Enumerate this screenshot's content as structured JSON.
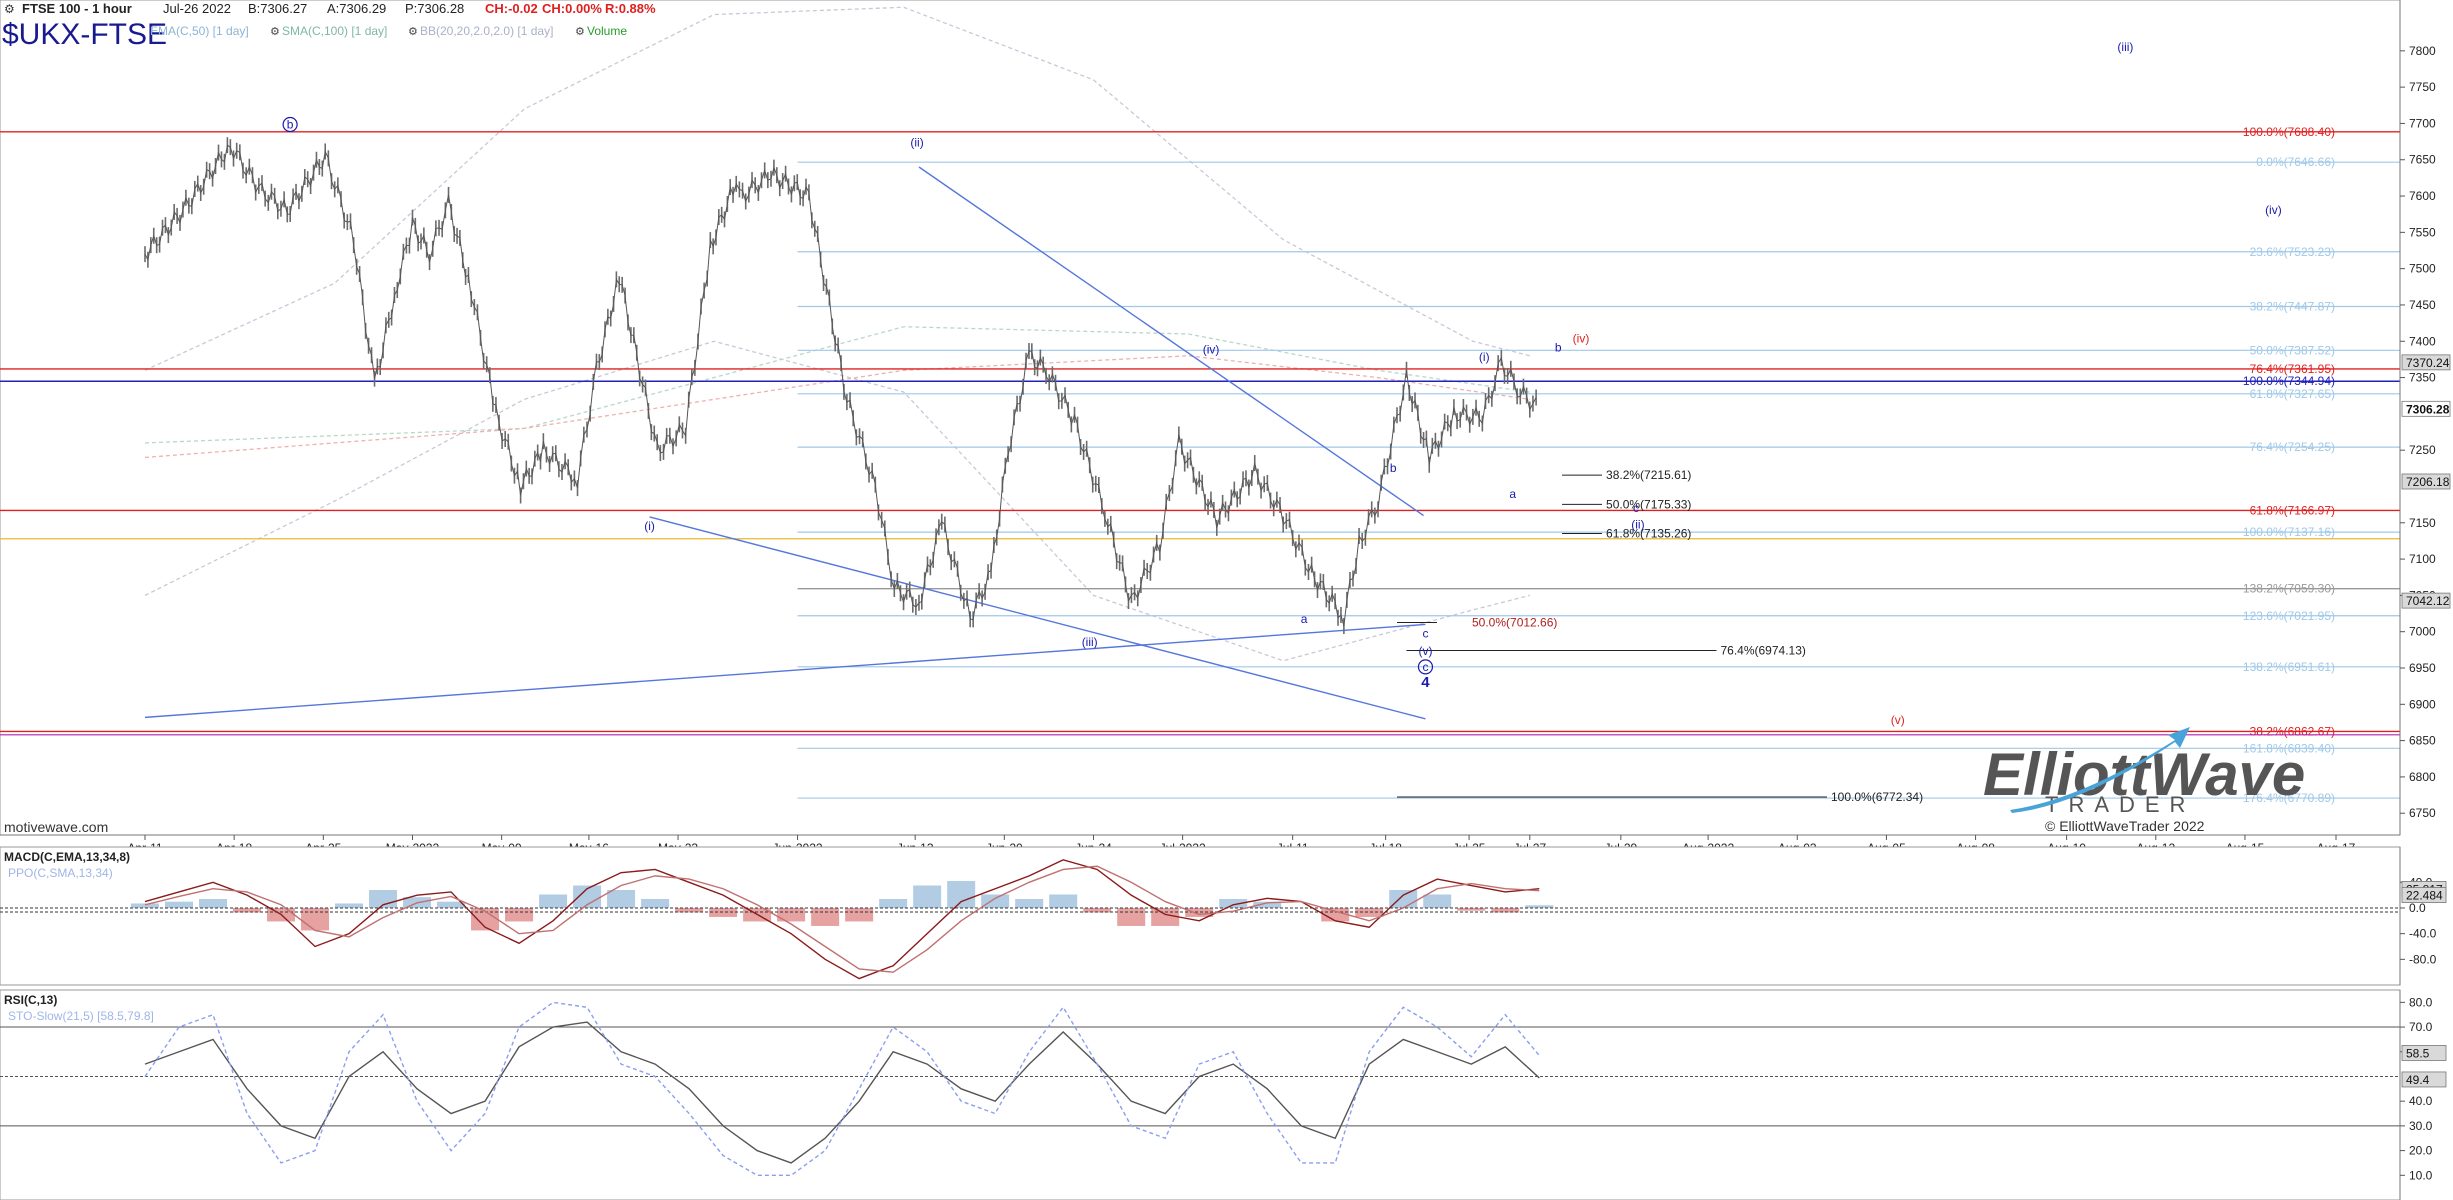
{
  "header": {
    "symbol_line": "FTSE 100 - 1 hour",
    "date": "Jul-26 2022",
    "bid": "B:7306.27",
    "ask": "A:7306.29",
    "price": "P:7306.28",
    "change": "CH:-0.02",
    "change_pct": "CH:0.00%",
    "range": "R:0.88%",
    "big_symbol": "$UKX-FTSE",
    "indicators": [
      "EMA(C,50) [1 day]",
      "SMA(C,100) [1 day]",
      "BB(20,20,2.0,2.0) [1 day]",
      "Volume"
    ],
    "watermark": "motivewave.com"
  },
  "logo": {
    "line1": "ElliottWave",
    "line2": "TRADER",
    "copyright": "© ElliottWaveTrader 2022"
  },
  "colors": {
    "price_bars": "#6b6b6b",
    "red": "#e02020",
    "blue": "#2222bb",
    "light_blue": "#9fc8e8",
    "label_blue": "#1a1ab0"
  },
  "chart_data": [
    {
      "type": "line",
      "title": "FTSE 100 - 1 hour",
      "ylim": [
        6720,
        7870
      ],
      "y_ticks": [
        7800,
        7750,
        7700,
        7650,
        7600,
        7550,
        7500,
        7450,
        7400,
        7350,
        7250,
        7150,
        7100,
        7050,
        7000,
        6950,
        6900,
        6850,
        6800,
        6750
      ],
      "x_tick_labels": [
        "Apr-11",
        "Apr-18",
        "Apr-25",
        "May-2022",
        "May-09",
        "May-16",
        "May-23",
        "Jun-2022",
        "Jun-13",
        "Jun-20",
        "Jun-24",
        "Jul-2022",
        "Jul-11",
        "Jul-18",
        "Jul-25",
        "Jul-27",
        "Jul-29",
        "Aug-2022",
        "Aug-03",
        "Aug-05",
        "Aug-08",
        "Aug-10",
        "Aug-12",
        "Aug-15",
        "Aug-17"
      ],
      "x_tick_positions": [
        0.0,
        0.047,
        0.094,
        0.141,
        0.188,
        0.234,
        0.281,
        0.344,
        0.406,
        0.453,
        0.5,
        0.547,
        0.605,
        0.654,
        0.698,
        0.73,
        0.778,
        0.824,
        0.871,
        0.918,
        0.965,
        1.013,
        1.06,
        1.107,
        1.155
      ],
      "price_series": {
        "name": "FTSE 100",
        "x": [
          0.0,
          0.02,
          0.045,
          0.06,
          0.075,
          0.095,
          0.11,
          0.121,
          0.133,
          0.141,
          0.15,
          0.16,
          0.172,
          0.185,
          0.198,
          0.21,
          0.228,
          0.238,
          0.25,
          0.27,
          0.285,
          0.298,
          0.31,
          0.315,
          0.33,
          0.35,
          0.37,
          0.385,
          0.395,
          0.408,
          0.42,
          0.435,
          0.446,
          0.455,
          0.466,
          0.475,
          0.49,
          0.506,
          0.52,
          0.535,
          0.545,
          0.565,
          0.585,
          0.6,
          0.615,
          0.632,
          0.64,
          0.65,
          0.665,
          0.677,
          0.69,
          0.705,
          0.715,
          0.725,
          0.735
        ],
        "y": [
          7520,
          7580,
          7670,
          7610,
          7580,
          7655,
          7540,
          7340,
          7480,
          7560,
          7520,
          7590,
          7470,
          7300,
          7200,
          7250,
          7210,
          7360,
          7490,
          7250,
          7280,
          7530,
          7610,
          7600,
          7630,
          7600,
          7320,
          7200,
          7060,
          7040,
          7150,
          7020,
          7080,
          7250,
          7380,
          7360,
          7290,
          7165,
          7040,
          7120,
          7260,
          7155,
          7220,
          7160,
          7080,
          7020,
          7120,
          7180,
          7350,
          7240,
          7300,
          7295,
          7370,
          7330,
          7306.28
        ]
      },
      "x_extent": [
        0,
        1.18
      ],
      "horizontal_levels": [
        {
          "label": "100.0%(7688.40)",
          "value": 7688.4,
          "color": "#e02020"
        },
        {
          "label": "0.0%(7646.66)",
          "value": 7646.66,
          "color": "#9fc8e8"
        },
        {
          "label": "23.6%(7523.23)",
          "value": 7523.23,
          "color": "#9fc8e8"
        },
        {
          "label": "38.2%(7447.87)",
          "value": 7447.87,
          "color": "#9fc8e8"
        },
        {
          "label": "50.0%(7387.52)",
          "value": 7387.52,
          "color": "#9fc8e8"
        },
        {
          "label": "76.4%(7361.95)",
          "value": 7361.95,
          "color": "#e02020"
        },
        {
          "label": "100.0%(7344.94)",
          "value": 7344.94,
          "color": "#2222bb"
        },
        {
          "label": "61.8%(7327.65)",
          "value": 7327.65,
          "color": "#9fc8e8"
        },
        {
          "label": "76.4%(7254.25)",
          "value": 7254.25,
          "color": "#9fc8e8"
        },
        {
          "label": "61.8%(7166.97)",
          "value": 7166.97,
          "color": "#e02020"
        },
        {
          "label": "100.0%(7137.16)",
          "value": 7137.16,
          "color": "#9fc8e8"
        },
        {
          "label": "138.2%(7059.30)",
          "value": 7059.3,
          "color": "#999999"
        },
        {
          "label": "123.6%(7021.95)",
          "value": 7021.95,
          "color": "#9fc8e8"
        },
        {
          "label": "138.2%(6951.61)",
          "value": 6951.61,
          "color": "#9fc8e8"
        },
        {
          "label": "38.2%(6862.67)",
          "value": 6862.67,
          "color": "#e02020"
        },
        {
          "label": "161.8%(6839.40)",
          "value": 6839.4,
          "color": "#9fc8e8"
        },
        {
          "label": "176.4%(6770.89)",
          "value": 6770.89,
          "color": "#9fc8e8"
        }
      ],
      "short_levels": [
        {
          "label": "38.2%(7215.61)",
          "value": 7215.61
        },
        {
          "label": "50.0%(7175.33)",
          "value": 7175.33
        },
        {
          "label": "61.8%(7135.26)",
          "value": 7135.26
        },
        {
          "label": "50.0%(7012.66)",
          "value": 7012.66
        },
        {
          "label": "76.4%(6974.13)",
          "value": 6974.13
        },
        {
          "label": "100.0%(6772.34)",
          "value": 6772.34
        }
      ],
      "price_boxes": [
        {
          "label": "7370.24",
          "value": 7370.24
        },
        {
          "label": "7306.28",
          "value": 7306.28
        },
        {
          "label": "7206.18",
          "value": 7206.18
        },
        {
          "label": "7042.12",
          "value": 7042.12
        }
      ],
      "wave_labels": [
        {
          "text": "b",
          "x": 0.0765,
          "y": 7693,
          "color": "#1a1ab0",
          "circle": true
        },
        {
          "text": "(ii)",
          "x": 0.407,
          "y": 7668,
          "color": "#1a1ab0"
        },
        {
          "text": "(i)",
          "x": 0.266,
          "y": 7140,
          "color": "#1a1ab0"
        },
        {
          "text": "(iii)",
          "x": 0.498,
          "y": 6980,
          "color": "#1a1ab0"
        },
        {
          "text": "(iv)",
          "x": 0.562,
          "y": 7383,
          "color": "#1a1ab0"
        },
        {
          "text": "a",
          "x": 0.611,
          "y": 7012,
          "color": "#1a1ab0"
        },
        {
          "text": "b",
          "x": 0.658,
          "y": 7220,
          "color": "#1a1ab0"
        },
        {
          "text": "c",
          "x": 0.675,
          "y": 6992,
          "color": "#1a1ab0"
        },
        {
          "text": "(v)",
          "x": 0.675,
          "y": 6968,
          "color": "#1a1ab0"
        },
        {
          "text": "c",
          "x": 0.675,
          "y": 6946,
          "color": "#1a1ab0",
          "circle": true
        },
        {
          "text": "4",
          "x": 0.675,
          "y": 6924,
          "color": "#1a1ab0"
        },
        {
          "text": "(i)",
          "x": 0.706,
          "y": 7373,
          "color": "#1a1ab0"
        },
        {
          "text": "a",
          "x": 0.721,
          "y": 7184,
          "color": "#1a1ab0"
        },
        {
          "text": "b",
          "x": 0.745,
          "y": 7386,
          "color": "#1a1ab0"
        },
        {
          "text": "(iv)",
          "x": 0.757,
          "y": 7398,
          "color": "#e02020"
        },
        {
          "text": "c",
          "x": 0.786,
          "y": 7165,
          "color": "#1a1ab0"
        },
        {
          "text": "(ii)",
          "x": 0.787,
          "y": 7142,
          "color": "#1a1ab0"
        },
        {
          "text": "(iii)",
          "x": 1.044,
          "y": 7800,
          "color": "#1a1ab0"
        },
        {
          "text": "(iv)",
          "x": 1.122,
          "y": 7575,
          "color": "#1a1ab0"
        },
        {
          "text": "(v)",
          "x": 0.924,
          "y": 6873,
          "color": "#e02020"
        }
      ],
      "trendlines": [
        {
          "from": [
            0.408,
            7640
          ],
          "to": [
            0.674,
            7160
          ]
        },
        {
          "from": [
            0.266,
            7158
          ],
          "to": [
            0.675,
            6880
          ]
        },
        {
          "from": [
            0.0,
            6882
          ],
          "to": [
            0.675,
            7010
          ]
        }
      ]
    },
    {
      "type": "line",
      "title": "MACD(C,EMA,13,34,8)",
      "subtitle": "PPO(C,SMA,13,34)",
      "ylim": [
        -120,
        95
      ],
      "y_ticks": [
        40.0,
        0.0,
        -40.0,
        -80.0
      ],
      "value_boxes": [
        {
          "label": "25.817",
          "value": 25.817
        },
        {
          "label": "22.484",
          "value": 22.484
        }
      ],
      "series": [
        {
          "name": "MACD",
          "values": [
            10,
            25,
            40,
            20,
            -10,
            -60,
            -40,
            5,
            20,
            25,
            -30,
            -55,
            -20,
            30,
            55,
            60,
            40,
            20,
            -10,
            -40,
            -80,
            -110,
            -90,
            -40,
            10,
            30,
            50,
            75,
            60,
            20,
            -10,
            -20,
            5,
            15,
            10,
            -20,
            -30,
            20,
            45,
            35,
            25,
            30
          ]
        },
        {
          "name": "Signal",
          "values": [
            5,
            18,
            30,
            25,
            5,
            -35,
            -45,
            -15,
            8,
            18,
            -5,
            -40,
            -35,
            5,
            35,
            50,
            45,
            30,
            5,
            -25,
            -60,
            -95,
            -100,
            -65,
            -20,
            15,
            40,
            60,
            65,
            40,
            10,
            -10,
            -5,
            8,
            10,
            -5,
            -20,
            0,
            30,
            38,
            30,
            27
          ]
        }
      ]
    },
    {
      "type": "line",
      "title": "RSI(C,13)",
      "subtitle": "STO-Slow(21,5) [58.5,79.8]",
      "ylim": [
        0,
        85
      ],
      "y_ticks": [
        80.0,
        70.0,
        60.0,
        40.0,
        30.0,
        20.0,
        10.0
      ],
      "value_boxes": [
        {
          "label": "58.5",
          "value": 58.5
        },
        {
          "label": "49.4",
          "value": 49.4
        }
      ],
      "series": [
        {
          "name": "RSI",
          "values": [
            55,
            60,
            65,
            45,
            30,
            25,
            50,
            60,
            45,
            35,
            40,
            62,
            70,
            72,
            60,
            55,
            45,
            30,
            20,
            15,
            25,
            40,
            60,
            55,
            45,
            40,
            55,
            68,
            55,
            40,
            35,
            50,
            55,
            45,
            30,
            25,
            55,
            65,
            60,
            55,
            62,
            49.4
          ]
        },
        {
          "name": "STO-Slow",
          "values": [
            50,
            70,
            75,
            35,
            15,
            20,
            60,
            75,
            40,
            20,
            35,
            70,
            80,
            78,
            55,
            50,
            35,
            18,
            10,
            10,
            20,
            45,
            70,
            60,
            40,
            35,
            60,
            78,
            55,
            30,
            25,
            55,
            60,
            35,
            15,
            15,
            60,
            78,
            70,
            58,
            75,
            58.5
          ]
        }
      ]
    }
  ]
}
